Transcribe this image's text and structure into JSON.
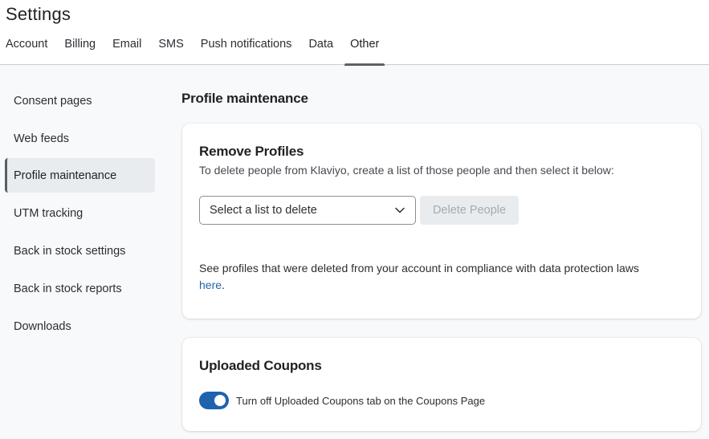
{
  "header": {
    "title": "Settings",
    "tabs": [
      {
        "label": "Account",
        "active": false
      },
      {
        "label": "Billing",
        "active": false
      },
      {
        "label": "Email",
        "active": false
      },
      {
        "label": "SMS",
        "active": false
      },
      {
        "label": "Push notifications",
        "active": false
      },
      {
        "label": "Data",
        "active": false
      },
      {
        "label": "Other",
        "active": true
      }
    ]
  },
  "sidebar": {
    "items": [
      {
        "label": "Consent pages",
        "active": false
      },
      {
        "label": "Web feeds",
        "active": false
      },
      {
        "label": "Profile maintenance",
        "active": true
      },
      {
        "label": "UTM tracking",
        "active": false
      },
      {
        "label": "Back in stock settings",
        "active": false
      },
      {
        "label": "Back in stock reports",
        "active": false
      },
      {
        "label": "Downloads",
        "active": false
      }
    ]
  },
  "main": {
    "section_title": "Profile maintenance",
    "remove_profiles": {
      "heading": "Remove Profiles",
      "description": "To delete people from Klaviyo, create a list of those people and then select it below:",
      "select_placeholder": "Select a list to delete",
      "delete_button": "Delete People",
      "delete_button_disabled": true,
      "compliance_text": "See profiles that were deleted from your account in compliance with data protection laws",
      "compliance_link": "here",
      "compliance_suffix": "."
    },
    "uploaded_coupons": {
      "heading": "Uploaded Coupons",
      "toggle_label": "Turn off Uploaded Coupons tab on the Coupons Page",
      "toggle_on": true
    }
  },
  "colors": {
    "accent": "#1f62ad",
    "link": "#2563a8",
    "active_indicator": "#5e6166",
    "disabled_button_bg": "#e9ecef",
    "disabled_button_text": "#a6aab0"
  }
}
